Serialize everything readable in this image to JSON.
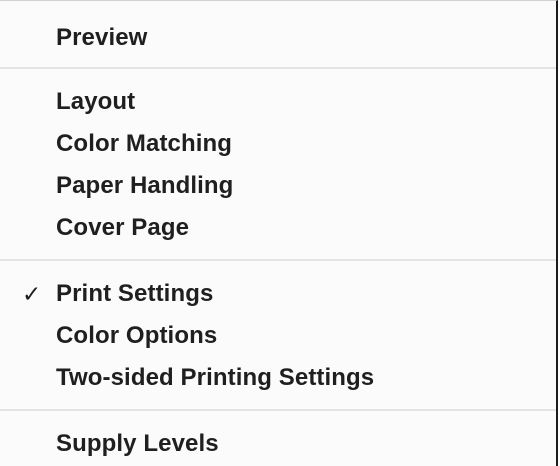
{
  "menu": {
    "groups": [
      {
        "items": [
          {
            "label": "Preview",
            "checked": false
          }
        ]
      },
      {
        "items": [
          {
            "label": "Layout",
            "checked": false
          },
          {
            "label": "Color Matching",
            "checked": false
          },
          {
            "label": "Paper Handling",
            "checked": false
          },
          {
            "label": "Cover Page",
            "checked": false
          }
        ]
      },
      {
        "items": [
          {
            "label": "Print Settings",
            "checked": true
          },
          {
            "label": "Color Options",
            "checked": false
          },
          {
            "label": "Two-sided Printing Settings",
            "checked": false
          }
        ]
      },
      {
        "items": [
          {
            "label": "Supply Levels",
            "checked": false
          }
        ]
      }
    ],
    "check_mark": "✓"
  }
}
